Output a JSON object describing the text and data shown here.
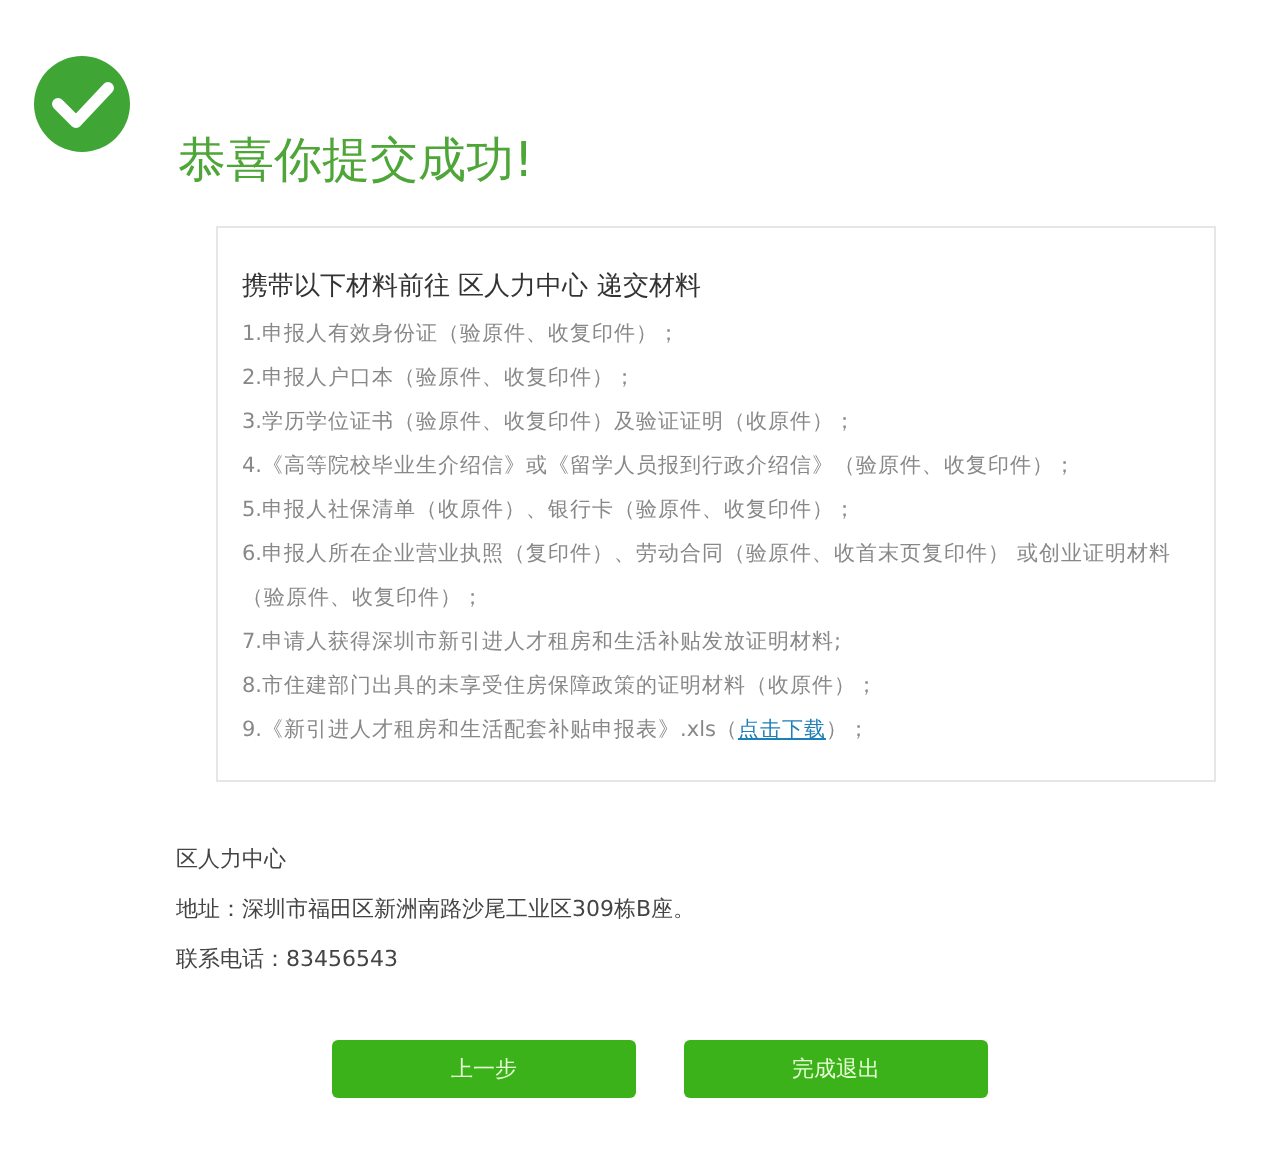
{
  "title": "恭喜你提交成功!",
  "materials": {
    "heading": "携带以下材料前往 区人力中心 递交材料",
    "items": [
      {
        "text": "1.申报人有效身份证（验原件、收复印件）；"
      },
      {
        "text": "2.申报人户口本（验原件、收复印件）；"
      },
      {
        "text": "3.学历学位证书（验原件、收复印件）及验证证明（收原件）；"
      },
      {
        "text": "4.《高等院校毕业生介绍信》或《留学人员报到行政介绍信》（验原件、收复印件）；"
      },
      {
        "text": "5.申报人社保清单（收原件）、银行卡（验原件、收复印件）；"
      },
      {
        "text": "6.申报人所在企业营业执照（复印件）、劳动合同（验原件、收首末页复印件） 或创业证明材料（验原件、收复印件）；"
      },
      {
        "text": "7.申请人获得深圳市新引进人才租房和生活补贴发放证明材料;"
      },
      {
        "text": "8.市住建部门出具的未享受住房保障政策的证明材料（收原件）；"
      },
      {
        "text": "9.《新引进人才租房和生活配套补贴申报表》.xls（",
        "link": "点击下载",
        "after": "）；"
      }
    ]
  },
  "contact": [
    "区人力中心",
    "地址：深圳市福田区新洲南路沙尾工业区309栋B座。",
    "联系电话：83456543"
  ],
  "buttons": [
    "上一步",
    "完成退出"
  ]
}
